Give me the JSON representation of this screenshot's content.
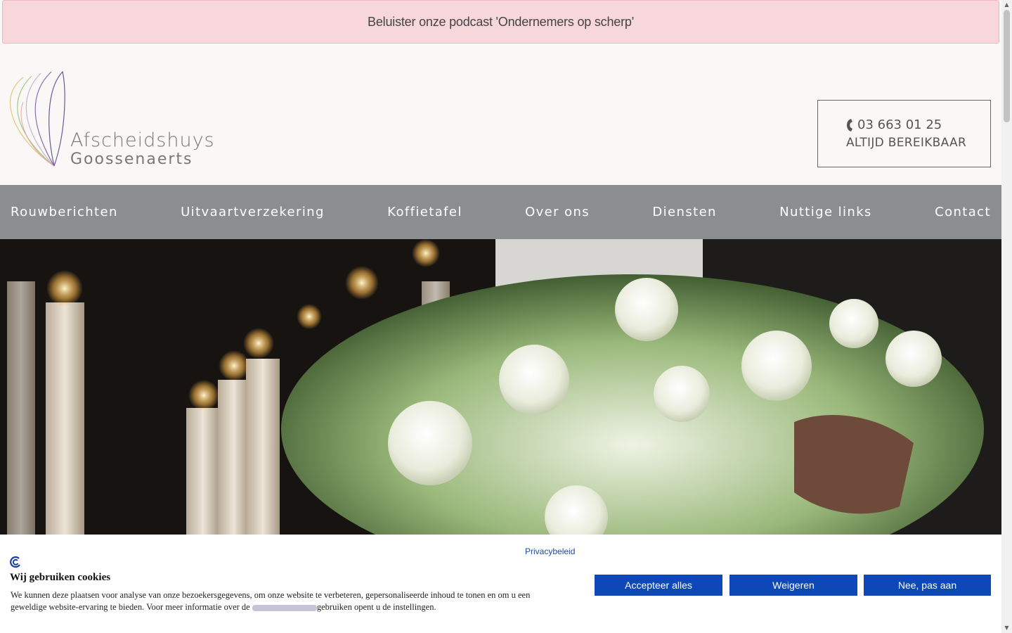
{
  "announcement": {
    "text": "Beluister onze podcast 'Ondernemers op scherp'"
  },
  "logo": {
    "line1": "Afscheidshuys",
    "line2": "Goossenaerts"
  },
  "contact": {
    "phone": "03 663 01 25",
    "availability": "ALTIJD BEREIKBAAR"
  },
  "nav": {
    "items": [
      {
        "label": "Rouwberichten"
      },
      {
        "label": "Uitvaartverzekering"
      },
      {
        "label": "Koffietafel"
      },
      {
        "label": "Over ons"
      },
      {
        "label": "Diensten"
      },
      {
        "label": "Nuttige links"
      },
      {
        "label": "Contact"
      }
    ]
  },
  "cookie": {
    "privacy_link": "Privacybeleid",
    "title": "Wij gebruiken cookies",
    "text_before": "We kunnen deze plaatsen voor analyse van onze bezoekersgegevens, om onze website te verbeteren, gepersonaliseerde inhoud te tonen en om u een geweldige website-ervaring te bieden. Voor meer informatie over de",
    "text_after": "gebruiken opent u de instellingen.",
    "accept_label": "Accepteer alles",
    "decline_label": "Weigeren",
    "customize_label": "Nee, pas aan"
  },
  "colors": {
    "announcement_bg": "#f8d7dc",
    "nav_bg": "#8a8e90",
    "button_bg": "#0e48b8",
    "link": "#1b4a9a"
  },
  "icons": {
    "phone": "phone-icon",
    "cookie": "cookie-consent-icon"
  }
}
